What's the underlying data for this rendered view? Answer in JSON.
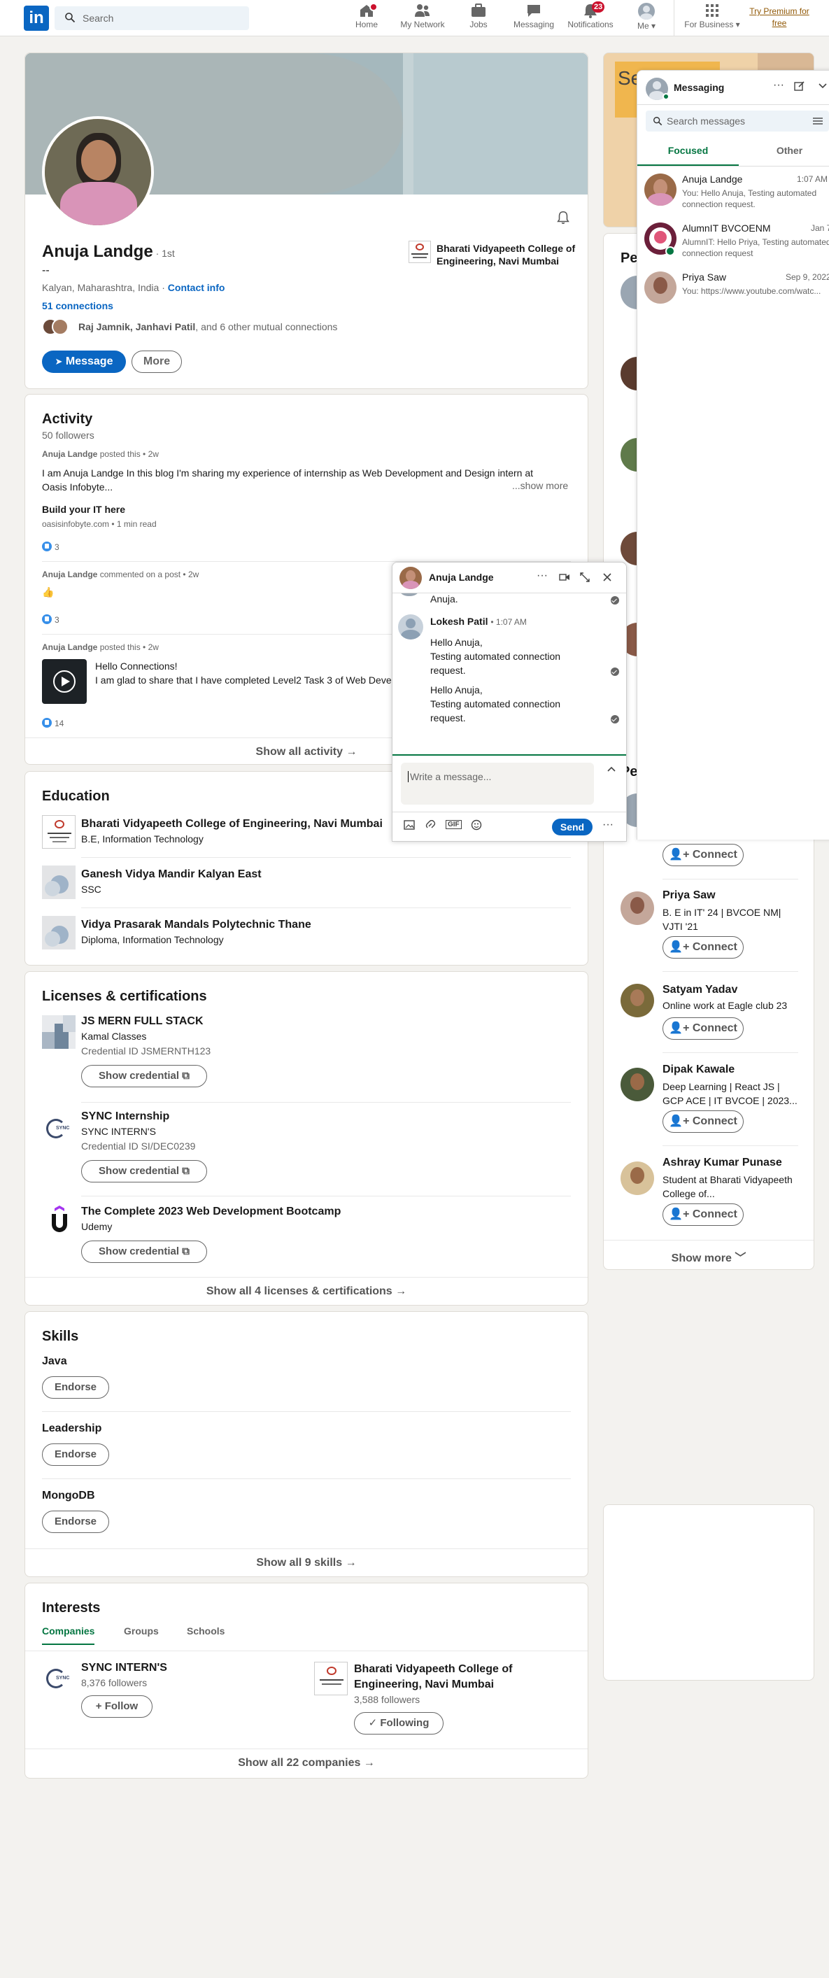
{
  "nav": {
    "search_placeholder": "Search",
    "items": [
      {
        "label": "Home"
      },
      {
        "label": "My Network"
      },
      {
        "label": "Jobs"
      },
      {
        "label": "Messaging"
      },
      {
        "label": "Notifications",
        "badge": "23"
      },
      {
        "label": "Me"
      },
      {
        "label": "For Business"
      }
    ],
    "premium": "Try Premium for free"
  },
  "profile": {
    "name": "Anuja Landge",
    "degree": "· 1st",
    "headline": "--",
    "location": "Kalyan, Maharashtra, India",
    "contact": "Contact info",
    "connections": "51 connections",
    "mutual_names": "Raj Jamnik, Janhavi Patil",
    "mutual_rest": ", and 6 other mutual connections",
    "education": "Bharati Vidyapeeth College of Engineering, Navi Mumbai",
    "message_btn": "Message",
    "more_btn": "More"
  },
  "activity": {
    "title": "Activity",
    "followers": "50 followers",
    "posts": [
      {
        "author": "Anuja Landge",
        "meta": "posted this • 2w",
        "text": "I am Anuja Landge In this blog I'm sharing my experience of internship as Web Development and Design intern at Oasis Infobyte...",
        "show_more": "...show more",
        "link_title": "Build your IT here",
        "link_meta": "oasisinfobyte.com • 1 min read",
        "likes": "3"
      },
      {
        "author": "Anuja Landge",
        "meta": "commented on a post • 2w",
        "text": "👍",
        "likes": "3"
      },
      {
        "author": "Anuja Landge",
        "meta": "posted this • 2w",
        "text": "Hello Connections!\nI am glad to share that I have completed Level2 Task 3 of Web Development of Oasis Infobyte...",
        "likes": "14"
      }
    ],
    "show_all": "Show all activity →"
  },
  "education": {
    "title": "Education",
    "items": [
      {
        "school": "Bharati Vidyapeeth College of Engineering, Navi Mumbai",
        "degree": "B.E, Information Technology"
      },
      {
        "school": "Ganesh Vidya Mandir Kalyan East",
        "degree": "SSC"
      },
      {
        "school": "Vidya Prasarak Mandals Polytechnic Thane",
        "degree": "Diploma, Information Technology"
      }
    ]
  },
  "licenses": {
    "title": "Licenses & certifications",
    "items": [
      {
        "name": "JS MERN FULL STACK",
        "issuer": "Kamal Classes",
        "credential": "Credential ID JSMERNTH123",
        "btn": "Show credential"
      },
      {
        "name": "SYNC Internship",
        "issuer": "SYNC INTERN'S",
        "credential": "Credential ID SI/DEC0239",
        "btn": "Show credential"
      },
      {
        "name": "The Complete 2023 Web Development Bootcamp",
        "issuer": "Udemy",
        "btn": "Show credential"
      }
    ],
    "show_all": "Show all 4 licenses & certifications →"
  },
  "skills": {
    "title": "Skills",
    "items": [
      {
        "name": "Java",
        "btn": "Endorse"
      },
      {
        "name": "Leadership",
        "btn": "Endorse"
      },
      {
        "name": "MongoDB",
        "btn": "Endorse"
      }
    ],
    "show_all": "Show all 9 skills →"
  },
  "interests": {
    "title": "Interests",
    "tabs": [
      "Companies",
      "Groups",
      "Schools"
    ],
    "items": [
      {
        "name": "SYNC INTERN'S",
        "followers": "8,376 followers",
        "btn": "+ Follow"
      },
      {
        "name": "Bharati Vidyapeeth College of Engineering, Navi Mumbai",
        "followers": "3,588 followers",
        "btn": "✓ Following"
      }
    ],
    "show_all": "Show all 22 companies →"
  },
  "sidebar": {
    "ad_text": "See who's on",
    "section1": "Pe",
    "section2": "Pe",
    "people": [
      {
        "name": "Priya Saw",
        "headline": "B. E in IT' 24 | BVCOE NM| VJTI '21",
        "btn": "Connect"
      },
      {
        "name": "Satyam Yadav",
        "headline": "Online work at Eagle club 23",
        "btn": "Connect"
      },
      {
        "name": "Dipak Kawale",
        "headline": "Deep Learning | React JS | GCP ACE | IT BVCOE | 2023...",
        "btn": "Connect"
      },
      {
        "name": "Ashray Kumar Punase",
        "headline": "Student at Bharati Vidyapeeth College of...",
        "btn": "Connect"
      }
    ],
    "top_connect": "Connect",
    "show_more": "Show more"
  },
  "messaging": {
    "title": "Messaging",
    "search_placeholder": "Search messages",
    "tabs": [
      "Focused",
      "Other"
    ],
    "conversations": [
      {
        "name": "Anuja Landge",
        "time": "1:07 AM",
        "preview": "You: Hello Anuja, Testing automated connection request."
      },
      {
        "name": "AlumnIT BVCOENM",
        "time": "Jan 7",
        "preview": "AlumnIT: Hello Priya, Testing automated connection request"
      },
      {
        "name": "Priya Saw",
        "time": "Sep 9, 2022",
        "preview": "You: https://www.youtube.com/watc..."
      }
    ]
  },
  "chat": {
    "name": "Anuja Landge",
    "top_fragment": "Anuja.",
    "sender": "Lokesh Patil",
    "sender_time": "• 1:07 AM",
    "messages": [
      "Hello Anuja,\nTesting automated connection request.",
      "Hello Anuja,\nTesting automated connection request."
    ],
    "input_placeholder": "Write a message...",
    "send": "Send"
  },
  "colors": {
    "brand": "#0a66c2",
    "focus_green": "#057642",
    "badge_red": "#cb112d"
  }
}
